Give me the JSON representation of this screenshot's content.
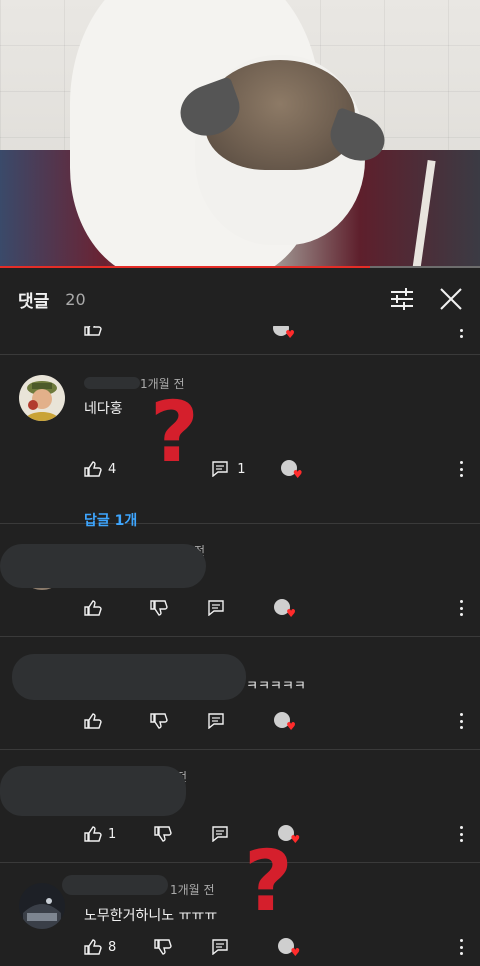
{
  "comments_panel": {
    "title": "댓글",
    "count": "20",
    "filter_icon": "sliders-icon",
    "close_icon": "close-icon"
  },
  "video": {
    "progress_fraction": 0.77
  },
  "comments": [
    {
      "author": "",
      "time": "1개월 전",
      "text": "네다홍",
      "likes": "4",
      "replies": "1",
      "reply_link": "답글 1개"
    },
    {
      "author": "",
      "time": "전",
      "text": "",
      "likes": "",
      "replies": ""
    },
    {
      "author": "",
      "time": "",
      "text": "ㅋㅋㅋㅋㅋ",
      "likes": "",
      "replies": ""
    },
    {
      "author": "",
      "time": "전",
      "text": "",
      "likes": "1",
      "replies": ""
    },
    {
      "author": "",
      "time": "1개월 전",
      "text": "노무한거하니노 ㅠㅠㅠ",
      "likes": "8",
      "replies": ""
    }
  ],
  "colors": {
    "accent": "#3ea6ff",
    "overlay_mark": "#d51f2c",
    "progress": "#e52d27"
  }
}
